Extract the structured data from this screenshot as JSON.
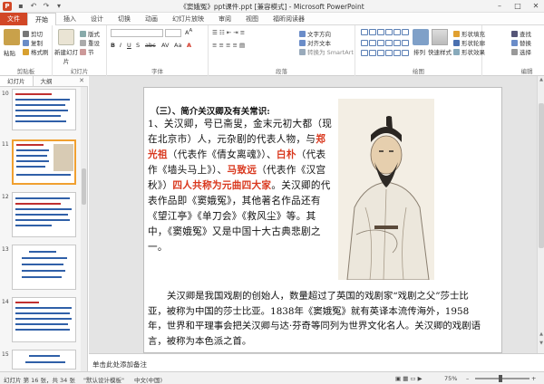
{
  "window": {
    "title": "《窦娥冤》ppt课件.ppt [兼容模式] - Microsoft PowerPoint",
    "app_icon_letter": "P"
  },
  "tabs": [
    {
      "label": "文件"
    },
    {
      "label": "开始"
    },
    {
      "label": "插入"
    },
    {
      "label": "设计"
    },
    {
      "label": "切换"
    },
    {
      "label": "动画"
    },
    {
      "label": "幻灯片放映"
    },
    {
      "label": "审阅"
    },
    {
      "label": "视图"
    },
    {
      "label": "福昕阅读器"
    }
  ],
  "ribbon": {
    "clipboard": {
      "paste": "粘贴",
      "cut": "剪切",
      "copy": "复制",
      "format_painter": "格式刷",
      "label": "剪贴板"
    },
    "slides": {
      "new_slide": "新建幻灯片",
      "layout": "版式",
      "reset": "重设",
      "section": "节",
      "label": "幻灯片"
    },
    "font": {
      "label": "字体"
    },
    "paragraph": {
      "text_direction": "文字方向",
      "align_text": "对齐文本",
      "smartart": "转换为 SmartArt",
      "label": "段落"
    },
    "drawing": {
      "arrange": "排列",
      "quick_styles": "快速样式",
      "fill": "形状填充",
      "outline": "形状轮廓",
      "effects": "形状效果",
      "label": "绘图"
    },
    "editing": {
      "find": "查找",
      "replace": "替换",
      "select": "选择",
      "label": "编辑"
    }
  },
  "left_panel": {
    "tab_slides": "幻灯片",
    "tab_outline": "大纲",
    "thumb_numbers": [
      "10",
      "11",
      "12",
      "13",
      "14",
      "15"
    ]
  },
  "slide": {
    "heading": "（三）、简介关汉卿及有关常识:",
    "para1_parts": [
      {
        "t": "1、关汉卿，号已斋叟，金末元初大都（现在北京市）人，元杂剧的代表人物，与",
        "red": false
      },
      {
        "t": "郑光祖",
        "red": true
      },
      {
        "t": "（代表作《倩女离魂》）、",
        "red": false
      },
      {
        "t": "白朴",
        "red": true
      },
      {
        "t": "（代表作《墙头马上》）、",
        "red": false
      },
      {
        "t": "马致远",
        "red": true
      },
      {
        "t": "（代表作《汉宫秋》）",
        "red": false
      },
      {
        "t": "四人共称为元曲四大家",
        "red": true
      },
      {
        "t": "。关汉卿的代表作品即《窦娥冤》，其他著名作品还有《望江亭》《单刀会》《救风尘》等。其中，《窦娥冤》又是中国十大古典悲剧之一。",
        "red": false
      }
    ],
    "para2": "关汉卿是我国戏剧的创始人，数量超过了英国的戏剧家“戏剧之父”莎士比亚，被称为中国的莎士比亚。1838年《窦娥冤》就有英译本流传海外，1958年，世界和平理事会把关汉卿与达·芬奇等同列为世界文化名人。关汉卿的戏剧语言，被称为本色派之首。"
  },
  "notes": {
    "placeholder": "单击此处添加备注"
  },
  "status": {
    "slide_info": "幻灯片 第 16 张，共 34 张",
    "theme": "\"默认设计模板\"",
    "language": "中文(中国)",
    "zoom": "75%"
  },
  "colors": {
    "accent": "#d24726",
    "title_red": "#d9381e"
  }
}
